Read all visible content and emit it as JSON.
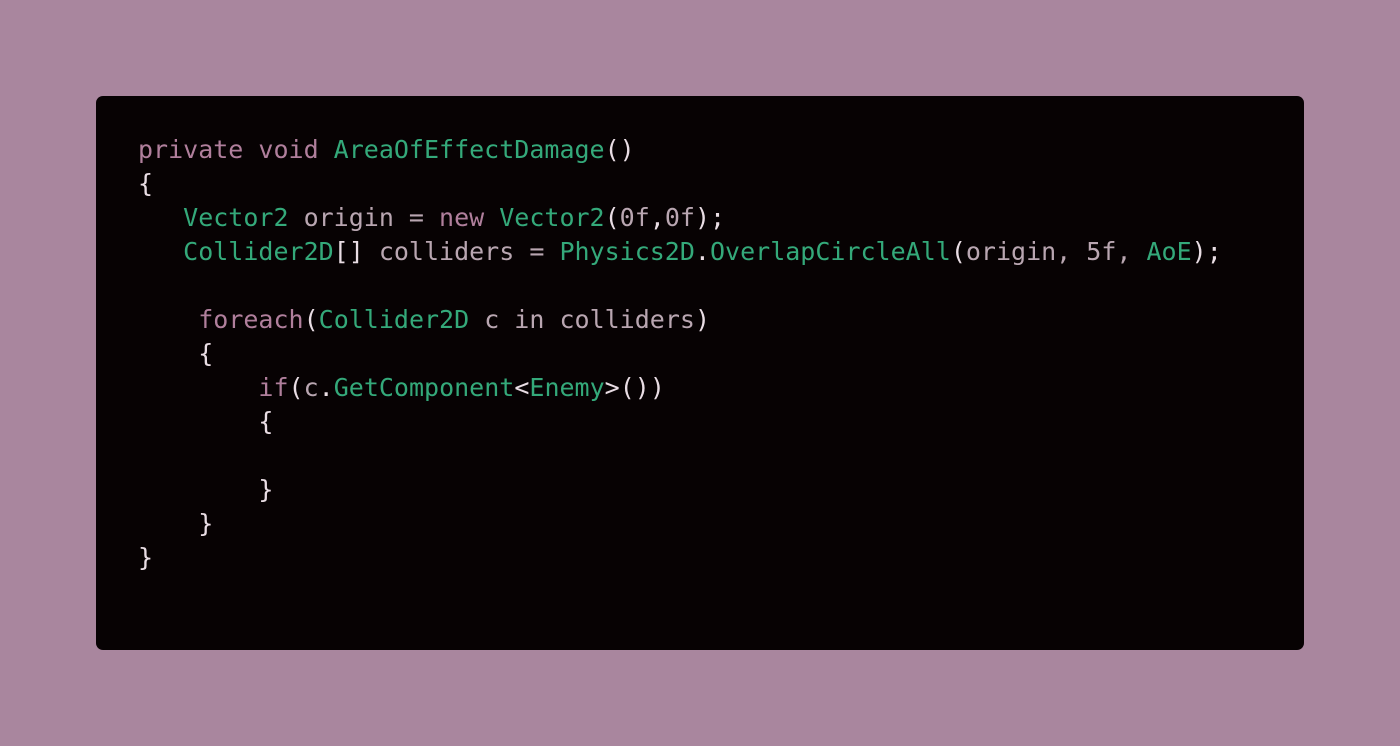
{
  "code": {
    "lines": [
      [
        {
          "text": "private void ",
          "kind": "kw"
        },
        {
          "text": "AreaOfEffectDamage",
          "kind": "ty"
        },
        {
          "text": "()",
          "kind": "pn"
        }
      ],
      [
        {
          "text": "{",
          "kind": "pn"
        }
      ],
      [
        {
          "text": "   ",
          "kind": "pn"
        },
        {
          "text": "Vector2",
          "kind": "ty"
        },
        {
          "text": " origin = ",
          "kind": "id"
        },
        {
          "text": "new ",
          "kind": "kw"
        },
        {
          "text": "Vector2",
          "kind": "ty"
        },
        {
          "text": "(",
          "kind": "pn"
        },
        {
          "text": "0f",
          "kind": "id"
        },
        {
          "text": ",",
          "kind": "pn"
        },
        {
          "text": "0f",
          "kind": "id"
        },
        {
          "text": ");",
          "kind": "pn"
        }
      ],
      [
        {
          "text": "   ",
          "kind": "pn"
        },
        {
          "text": "Collider2D",
          "kind": "ty"
        },
        {
          "text": "[] ",
          "kind": "pn"
        },
        {
          "text": "colliders = ",
          "kind": "id"
        },
        {
          "text": "Physics2D",
          "kind": "ty"
        },
        {
          "text": ".",
          "kind": "pn"
        },
        {
          "text": "OverlapCircleAll",
          "kind": "ty"
        },
        {
          "text": "(",
          "kind": "pn"
        },
        {
          "text": "origin, 5f, ",
          "kind": "id"
        },
        {
          "text": "AoE",
          "kind": "ty"
        },
        {
          "text": ");",
          "kind": "pn"
        }
      ],
      [],
      [
        {
          "text": "    ",
          "kind": "pn"
        },
        {
          "text": "foreach",
          "kind": "kw"
        },
        {
          "text": "(",
          "kind": "pn"
        },
        {
          "text": "Collider2D",
          "kind": "ty"
        },
        {
          "text": " c in colliders",
          "kind": "id"
        },
        {
          "text": ")",
          "kind": "pn"
        }
      ],
      [
        {
          "text": "    {",
          "kind": "pn"
        }
      ],
      [
        {
          "text": "        ",
          "kind": "pn"
        },
        {
          "text": "if",
          "kind": "kw"
        },
        {
          "text": "(",
          "kind": "pn"
        },
        {
          "text": "c",
          "kind": "id"
        },
        {
          "text": ".",
          "kind": "pn"
        },
        {
          "text": "GetComponent",
          "kind": "ty"
        },
        {
          "text": "<",
          "kind": "pn"
        },
        {
          "text": "Enemy",
          "kind": "ty"
        },
        {
          "text": ">())",
          "kind": "pn"
        }
      ],
      [
        {
          "text": "        {",
          "kind": "pn"
        }
      ],
      [],
      [
        {
          "text": "        }",
          "kind": "pn"
        }
      ],
      [
        {
          "text": "    }",
          "kind": "pn"
        }
      ],
      [
        {
          "text": "}",
          "kind": "pn"
        }
      ]
    ]
  },
  "colors": {
    "background": "#a9869e",
    "editor_background": "#070203",
    "keyword": "#b07f9c",
    "type": "#34a97a",
    "identifier": "#b9a6b1",
    "punctuation": "#e9dde4"
  }
}
